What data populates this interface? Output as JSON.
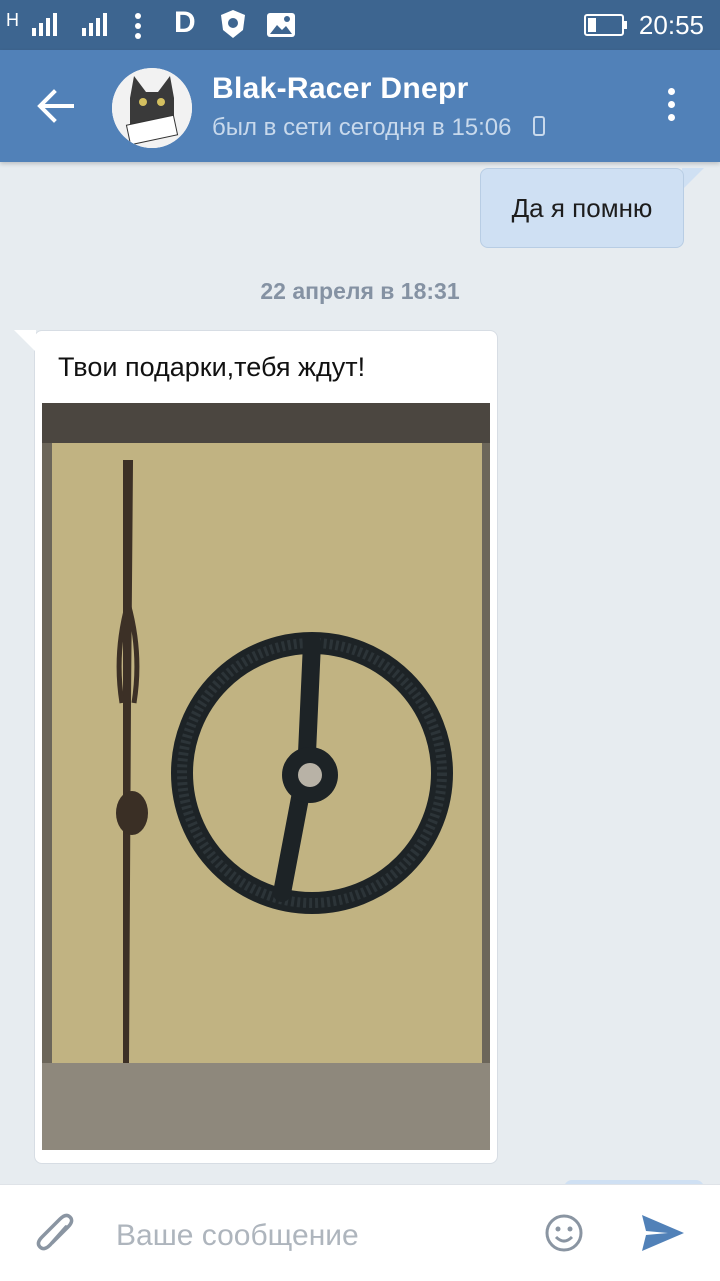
{
  "status_bar": {
    "time": "20:55",
    "network_label": "H",
    "carrier_icon_label": "D",
    "icons": [
      "network-h-icon",
      "signal-sim1-icon",
      "signal-sim2-icon",
      "dots-icon",
      "d-app-icon",
      "shield-app-icon",
      "image-icon",
      "battery-icon"
    ]
  },
  "header": {
    "contact_name": "Blak-Racer Dnepr",
    "last_seen": "был в сети сегодня в 15:06",
    "avatar_caption": "НАВАЛИВАЛ В ЦЕНТРЕ",
    "icons": [
      "back-arrow-icon",
      "mobile-phone-icon",
      "more-vert-icon"
    ]
  },
  "messages": [
    {
      "direction": "outgoing",
      "text": "Да я помню"
    },
    {
      "type": "date_separator",
      "text": "22 апреля в 18:31"
    },
    {
      "direction": "incoming",
      "text": "Твои подарки,тебя ждут!",
      "attachment": "photo of a steering wheel and steering column on a floor"
    }
  ],
  "composer": {
    "placeholder": "Ваше сообщение",
    "icons": [
      "paperclip-icon",
      "smiley-icon",
      "send-icon"
    ]
  },
  "colors": {
    "status_bar": "#3d6590",
    "header": "#5181b8",
    "background": "#e7ecf0",
    "outgoing_bubble": "#cfe0f3",
    "accent": "#5181b8"
  }
}
